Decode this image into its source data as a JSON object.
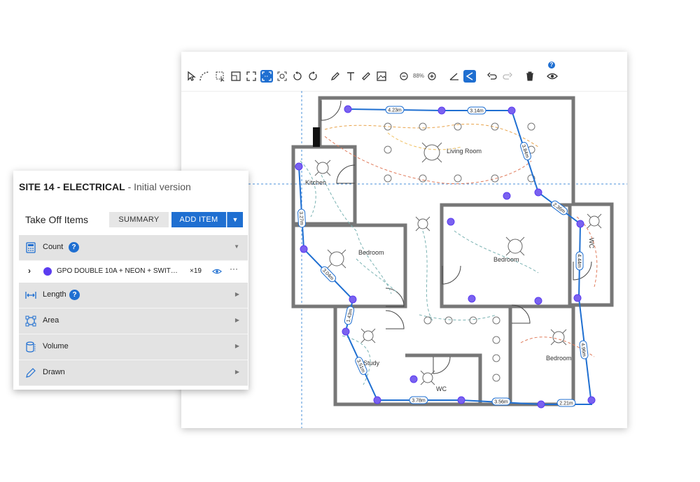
{
  "toolbar": {
    "zoom": "88%",
    "help": "?"
  },
  "panel": {
    "title": "SITE 14 - ELECTRICAL",
    "version": " - Initial version",
    "takeoff_label": "Take Off Items",
    "summary_btn": "SUMMARY",
    "add_btn": "ADD ITEM",
    "sections": [
      {
        "label": "Count",
        "icon": "calculator-icon"
      },
      {
        "label": "Length",
        "icon": "ruler-arrows-icon"
      },
      {
        "label": "Area",
        "icon": "area-icon"
      },
      {
        "label": "Volume",
        "icon": "cylinder-icon"
      },
      {
        "label": "Drawn",
        "icon": "pencil-icon"
      }
    ],
    "item": {
      "name": "GPO DOUBLE 10A + NEON + SWIT…",
      "count": "×19",
      "color": "#5b3cf0"
    }
  },
  "plan": {
    "rooms": [
      "Living Room",
      "Kitchen",
      "Bedroom",
      "Bedroom",
      "WC",
      "Study",
      "WC",
      "Bedroom"
    ],
    "measurements": [
      "4.23m",
      "3.14m",
      "3.84m",
      "2.36m",
      "4.44m",
      "4.96m",
      "2.21m",
      "3.56m",
      "3.78m",
      "3.51m",
      "1.43m",
      "3.04m",
      "3.27m"
    ]
  },
  "colors": {
    "accent": "#1f6fd1",
    "wall": "#777777",
    "point": "#5b3cf0"
  }
}
